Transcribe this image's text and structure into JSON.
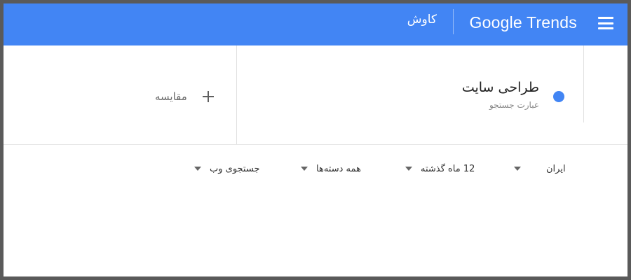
{
  "header": {
    "logo_text": "Google Trends",
    "explore_label": "کاوش",
    "menu_icon": "hamburger-menu-icon",
    "background_color": "#4285f4"
  },
  "search_term": {
    "title": "طراحی سایت",
    "subtitle": "عبارت جستجو",
    "dot_color": "#4285f4"
  },
  "compare": {
    "label": "مقایسه",
    "icon": "plus-icon"
  },
  "filters": [
    {
      "label": "ایران",
      "icon": "dropdown-arrow-icon"
    },
    {
      "label": "12 ماه گذشته",
      "icon": "dropdown-arrow-icon"
    },
    {
      "label": "همه دسته‌ها",
      "icon": "dropdown-arrow-icon"
    },
    {
      "label": "جستجوی وب",
      "icon": "dropdown-arrow-icon"
    }
  ]
}
